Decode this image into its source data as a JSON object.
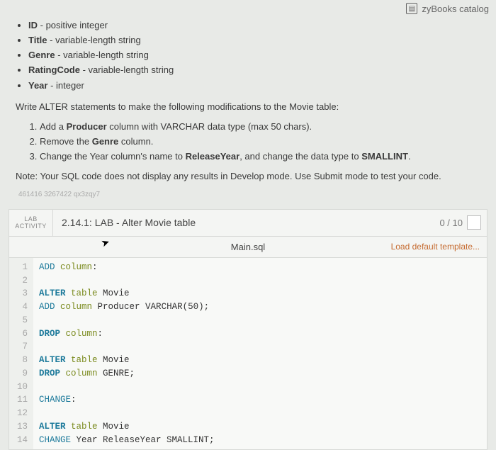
{
  "topbar": {
    "catalog_label": "zyBooks catalog"
  },
  "instructions": {
    "columns": [
      {
        "name": "ID",
        "desc": "positive integer"
      },
      {
        "name": "Title",
        "desc": "variable-length string"
      },
      {
        "name": "Genre",
        "desc": "variable-length string"
      },
      {
        "name": "RatingCode",
        "desc": "variable-length string"
      },
      {
        "name": "Year",
        "desc": "integer"
      }
    ],
    "lead": "Write ALTER statements to make the following modifications to the Movie table:",
    "step1_a": "Add a ",
    "step1_b": "Producer",
    "step1_c": " column with VARCHAR data type (max 50 chars).",
    "step2_a": "Remove the ",
    "step2_b": "Genre",
    "step2_c": " column.",
    "step3_a": "Change the Year column's name to ",
    "step3_b": "ReleaseYear",
    "step3_c": ", and change the data type to ",
    "step3_d": "SMALLINT",
    "step3_e": ".",
    "note": "Note: Your SQL code does not display any results in Develop mode. Use Submit mode to test your code.",
    "watermark": "461416 3267422 qx3zqy7"
  },
  "lab": {
    "tag_line1": "LAB",
    "tag_line2": "ACTIVITY",
    "title": "2.14.1: LAB - Alter Movie table",
    "score": "0 / 10",
    "file_tab": "Main.sql",
    "load_template": "Load default template..."
  },
  "code": {
    "lines": [
      "ADD column:",
      "",
      "ALTER table Movie",
      "ADD column Producer VARCHAR(50);",
      "",
      "DROP column:",
      "",
      "ALTER table Movie",
      "DROP column GENRE;",
      "",
      "CHANGE:",
      "",
      "ALTER table Movie",
      "CHANGE Year ReleaseYear SMALLINT;"
    ]
  }
}
